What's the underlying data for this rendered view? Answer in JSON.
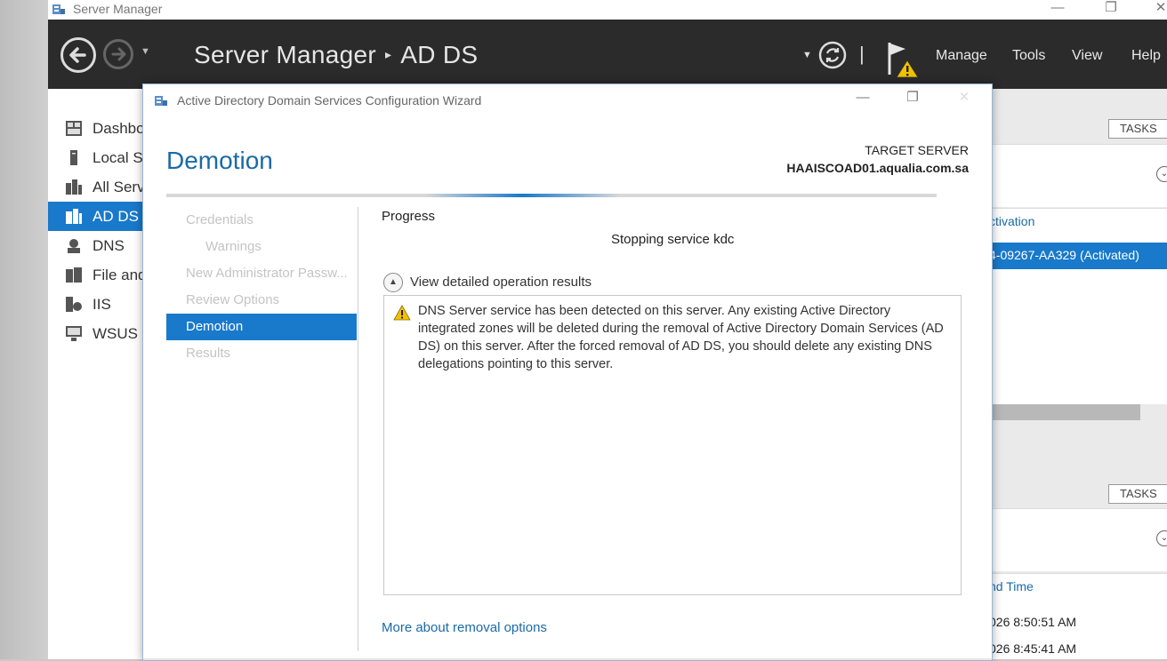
{
  "server_manager": {
    "window_title": "Server Manager",
    "controls": {
      "minimize": "—",
      "restore": "❐",
      "close": "✕"
    },
    "breadcrumb": {
      "root": "Server Manager",
      "separator": "▸",
      "current": "AD DS"
    },
    "menu": {
      "manage": "Manage",
      "tools": "Tools",
      "view": "View",
      "help": "Help"
    },
    "sidebar": [
      {
        "label": "Dashboard",
        "icon": "dashboard-icon",
        "active": false
      },
      {
        "label": "Local Server",
        "icon": "local-server-icon",
        "active": false
      },
      {
        "label": "All Servers",
        "icon": "all-servers-icon",
        "active": false
      },
      {
        "label": "AD DS",
        "icon": "ad-ds-icon",
        "active": true
      },
      {
        "label": "DNS",
        "icon": "dns-icon",
        "active": false
      },
      {
        "label": "File and Storage Services",
        "icon": "file-storage-icon",
        "active": false
      },
      {
        "label": "IIS",
        "icon": "iis-icon",
        "active": false
      },
      {
        "label": "WSUS",
        "icon": "wsus-icon",
        "active": false
      }
    ],
    "right_pane": {
      "tasks_label": "TASKS",
      "activation_text": "ctivation",
      "product_key_text": "4-09267-AA329 (Activated)",
      "column_header": "nd Time",
      "events": [
        "026 8:50:51 AM",
        "026 8:45:41 AM"
      ]
    }
  },
  "wizard": {
    "title": "Active Directory Domain Services Configuration Wizard",
    "heading": "Demotion",
    "target_server_label": "TARGET SERVER",
    "target_server_value": "HAAISCOAD01.aqualia.com.sa",
    "nav": [
      {
        "label": "Credentials",
        "indent": false,
        "active": false
      },
      {
        "label": "Warnings",
        "indent": true,
        "active": false
      },
      {
        "label": "New Administrator Passw...",
        "indent": false,
        "active": false
      },
      {
        "label": "Review Options",
        "indent": false,
        "active": false
      },
      {
        "label": "Demotion",
        "indent": false,
        "active": true
      },
      {
        "label": "Results",
        "indent": false,
        "active": false
      }
    ],
    "progress_label": "Progress",
    "status_text": "Stopping service kdc",
    "details_toggle": "View detailed operation results",
    "warning_message": "DNS Server service has been detected on this server. Any existing Active Directory integrated zones will be deleted during the removal of Active Directory Domain Services (AD DS) on this server. After the forced removal of AD DS, you should delete any existing DNS delegations pointing to this server.",
    "more_link": "More about removal options"
  },
  "colors": {
    "header_bg": "#2b2b2b",
    "accent_blue": "#1979ca",
    "heading_blue": "#1a6aa8",
    "warning_yellow": "#f2c200"
  }
}
